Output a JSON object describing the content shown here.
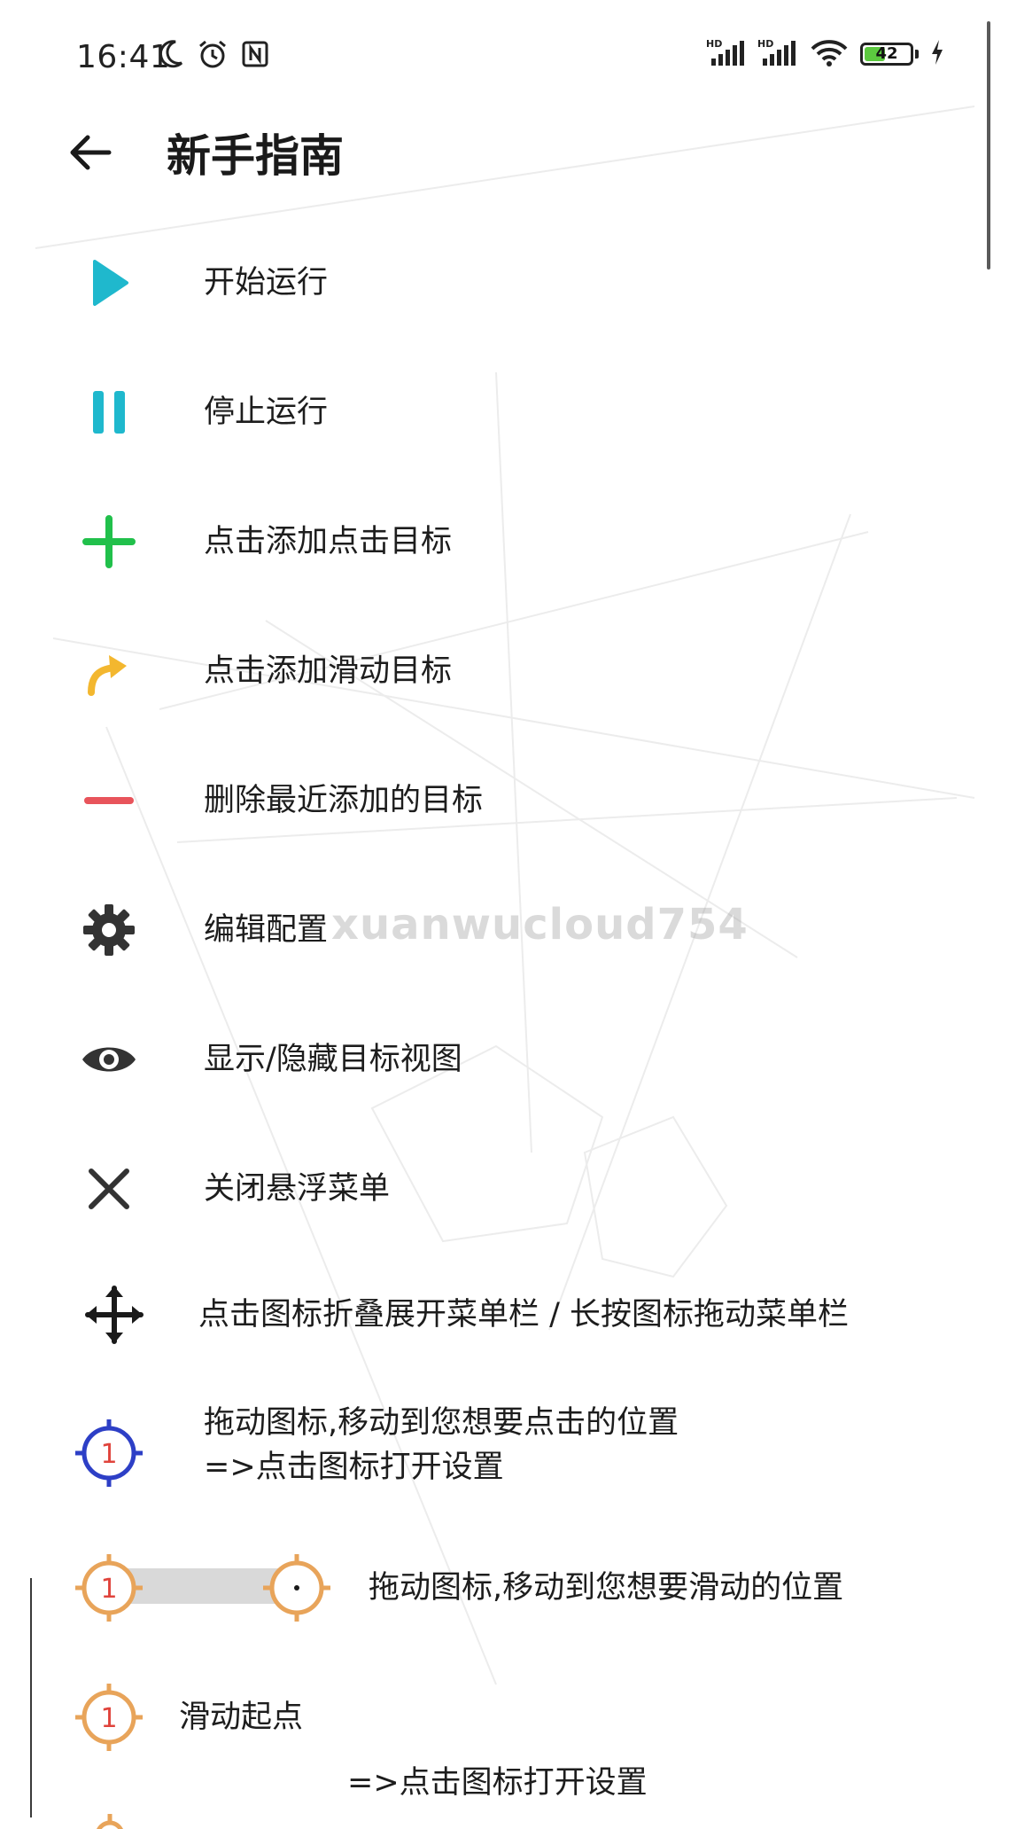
{
  "status_bar": {
    "time": "16:41",
    "battery_level": "42",
    "battery_fraction": 0.42,
    "left_icons": [
      "moon-icon",
      "alarm-icon",
      "nfc-icon"
    ],
    "right_icons": [
      "hd-signal-icon",
      "hd-signal-icon",
      "wifi-icon",
      "battery-icon",
      "charging-icon"
    ]
  },
  "header": {
    "title": "新手指南",
    "back_icon": "arrow-left-icon"
  },
  "watermark": "xuanwucloud754",
  "items": [
    {
      "icon": "play-icon",
      "color": "#1fb8cd",
      "text": "开始运行"
    },
    {
      "icon": "pause-icon",
      "color": "#1fb8cd",
      "text": "停止运行"
    },
    {
      "icon": "plus-icon",
      "color": "#21c04b",
      "text": "点击添加点击目标"
    },
    {
      "icon": "curved-arrow-icon",
      "color": "#f3b72f",
      "text": "点击添加滑动目标"
    },
    {
      "icon": "minus-icon",
      "color": "#e8545b",
      "text": "删除最近添加的目标"
    },
    {
      "icon": "gear-icon",
      "color": "#333333",
      "text": "编辑配置"
    },
    {
      "icon": "eye-icon",
      "color": "#333333",
      "text": "显示/隐藏目标视图"
    },
    {
      "icon": "close-icon",
      "color": "#333333",
      "text": "关闭悬浮菜单"
    },
    {
      "icon": "move-icon",
      "color": "#1a1a1a",
      "text": "点击图标折叠展开菜单栏 / 长按图标拖动菜单栏"
    },
    {
      "icon": "crosshair-target-icon",
      "color": "#2d3fc6",
      "label_color": "#e0443c",
      "target_label": "1",
      "text_line1": "拖动图标,移动到您想要点击的位置",
      "text_line2": "=>点击图标打开设置"
    },
    {
      "icon": "swipe-target-icon",
      "color": "#e8a45a",
      "start_label": "1",
      "text": "拖动图标,移动到您想要滑动的位置"
    },
    {
      "icon": "swipe-start-icon",
      "color": "#e8a45a",
      "label_color": "#e0443c",
      "target_label": "1",
      "text": "滑动起点",
      "subtext": "=>点击图标打开设置"
    }
  ]
}
